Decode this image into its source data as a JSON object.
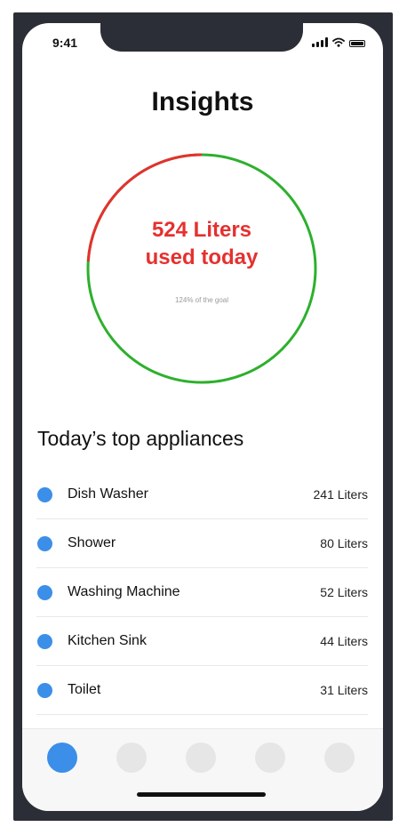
{
  "status_bar": {
    "time": "9:41",
    "icons": [
      "signal-icon",
      "wifi-icon",
      "battery-icon"
    ]
  },
  "header": {
    "title": "Insights"
  },
  "usage_ring": {
    "value_line1": "524 Liters",
    "value_line2": "used today",
    "goal_text": "124% of the goal",
    "goal_percent": 124,
    "colors": {
      "progress": "#2db02d",
      "overflow": "#e5312f",
      "value_text": "#e5312f"
    }
  },
  "appliances": {
    "title": "Today’s top appliances",
    "items": [
      {
        "name": "Dish Washer",
        "value": "241 Liters"
      },
      {
        "name": "Shower",
        "value": "80 Liters"
      },
      {
        "name": "Washing Machine",
        "value": "52 Liters"
      },
      {
        "name": "Kitchen Sink",
        "value": "44 Liters"
      },
      {
        "name": "Toilet",
        "value": "31 Liters"
      }
    ],
    "bullet_color": "#3b8fe8"
  },
  "tab_bar": {
    "tabs": [
      {
        "active": true
      },
      {
        "active": false
      },
      {
        "active": false
      },
      {
        "active": false
      },
      {
        "active": false
      }
    ],
    "active_color": "#3b8fe8"
  }
}
